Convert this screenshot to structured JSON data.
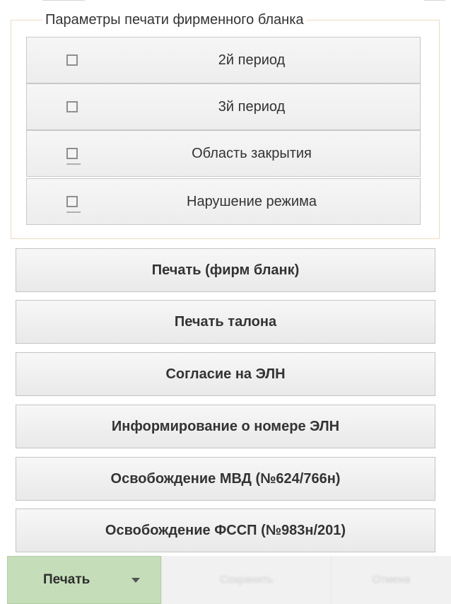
{
  "print_params": {
    "legend": "Параметры печати фирменного бланка",
    "options": [
      {
        "label": "2й период",
        "checked": false
      },
      {
        "label": "3й период",
        "checked": false
      },
      {
        "label": "Область закрытия",
        "checked": false
      },
      {
        "label": "Нарушение режима",
        "checked": false
      }
    ]
  },
  "buttons": {
    "print_letterhead": "Печать (фирм бланк)",
    "print_coupon": "Печать талона",
    "eln_consent": "Согласие на ЭЛН",
    "eln_number_info": "Информирование о номере ЭЛН",
    "mvd_release": "Освобождение МВД (№624/766н)",
    "fssp_release": "Освобождение ФССП (№983н/201)"
  },
  "bottom_bar": {
    "print_label": "Печать",
    "print_icon": "chevron-down-icon",
    "save_label": "Сохранить",
    "cancel_label": "Отмена"
  },
  "colors": {
    "print_button_bg": "#c5deb9",
    "fieldset_border": "#ecdcc2",
    "button_border": "#c4c4c4"
  }
}
